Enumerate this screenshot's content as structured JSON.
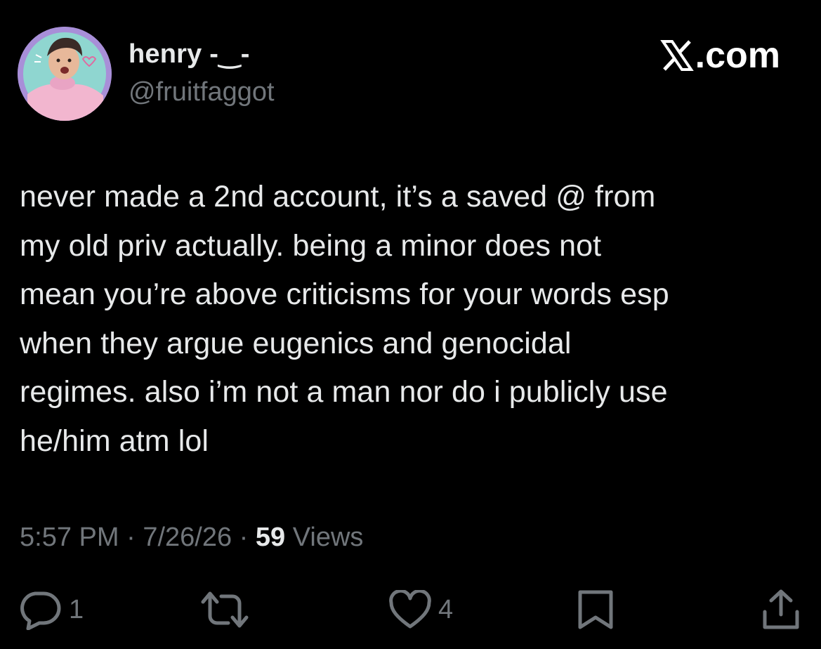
{
  "header": {
    "display_name": "henry -‿-",
    "handle": "@fruitfaggot",
    "brand": ".com"
  },
  "tweet": {
    "text": "never made a 2nd account, it’s a saved @ from\nmy old priv actually. being a minor does not\nmean you’re above criticisms for your words esp\nwhen they argue eugenics and genocidal\nregimes. also i’m not a man nor do i publicly use\nhe/him atm lol"
  },
  "meta": {
    "time": "5:57 PM",
    "sep1": " · ",
    "date": "7/26/26",
    "sep2": " · ",
    "views_count": "59",
    "views_label": " Views"
  },
  "actions": {
    "reply_count": "1",
    "like_count": "4"
  },
  "icons": {
    "avatar": "avatar-image",
    "brand": "x-logo-icon",
    "reply": "reply-icon",
    "repost": "repost-icon",
    "like": "heart-icon",
    "bookmark": "bookmark-icon",
    "share": "share-icon"
  },
  "colors": {
    "background": "#000000",
    "primary_text": "#e7e9ea",
    "secondary_text": "#71767b",
    "avatar_ring": "#a88fd8"
  }
}
